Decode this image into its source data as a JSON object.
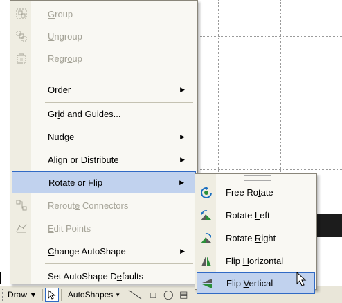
{
  "menu": {
    "items": [
      {
        "label": "Group",
        "disabled": true,
        "icon": "group-icon"
      },
      {
        "label": "Ungroup",
        "disabled": true,
        "icon": "ungroup-icon"
      },
      {
        "label": "Regroup",
        "disabled": true,
        "icon": "regroup-icon"
      },
      {
        "label": "Order",
        "disabled": false,
        "submenu": true
      },
      {
        "label": "Grid and Guides...",
        "disabled": false
      },
      {
        "label": "Nudge",
        "disabled": false,
        "submenu": true
      },
      {
        "label": "Align or Distribute",
        "disabled": false,
        "submenu": true
      },
      {
        "label": "Rotate or Flip",
        "disabled": false,
        "submenu": true,
        "highlighted": true
      },
      {
        "label": "Reroute Connectors",
        "disabled": true,
        "icon": "reroute-connectors-icon"
      },
      {
        "label": "Edit Points",
        "disabled": true,
        "icon": "edit-points-icon"
      },
      {
        "label": "Change AutoShape",
        "disabled": false,
        "submenu": true
      },
      {
        "label": "Set AutoShape Defaults",
        "disabled": false
      }
    ]
  },
  "submenu": {
    "items": [
      {
        "label": "Free Rotate",
        "icon": "free-rotate-icon"
      },
      {
        "label": "Rotate Left",
        "icon": "rotate-left-icon"
      },
      {
        "label": "Rotate Right",
        "icon": "rotate-right-icon"
      },
      {
        "label": "Flip Horizontal",
        "icon": "flip-horizontal-icon"
      },
      {
        "label": "Flip Vertical",
        "icon": "flip-vertical-icon",
        "highlighted": true
      }
    ]
  },
  "toolbar": {
    "draw_label": "Draw",
    "autoshapes_label": "AutoShapes"
  },
  "colors": {
    "menu_bg": "#f9f8f3",
    "highlight_bg": "#c1d2ee",
    "highlight_border": "#316ac5",
    "disabled_text": "#a5a397"
  }
}
